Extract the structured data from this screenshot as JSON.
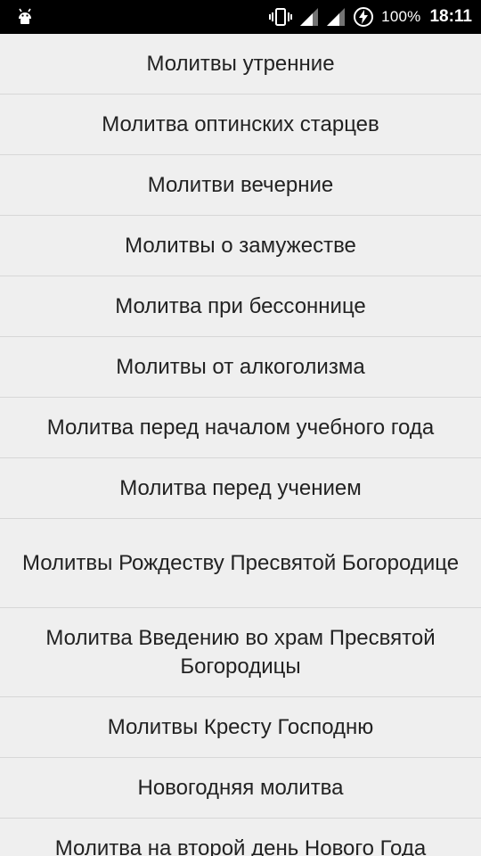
{
  "status_bar": {
    "left_icon": "android-notification-icon",
    "icons": [
      "vibrate-icon",
      "signal-icon",
      "signal-icon",
      "battery-charging-icon"
    ],
    "battery": "100%",
    "time": "18:11"
  },
  "prayers": {
    "items": [
      {
        "label": "Молитвы утренние"
      },
      {
        "label": "Молитва оптинских старцев"
      },
      {
        "label": "Молитви вечерние"
      },
      {
        "label": "Молитвы о замужестве"
      },
      {
        "label": "Молитва при бессоннице"
      },
      {
        "label": "Молитвы от алкоголизма"
      },
      {
        "label": "Молитва перед началом учебного года"
      },
      {
        "label": "Молитва перед учением"
      },
      {
        "label": "Молитвы Рождеству Пресвятой Богородице"
      },
      {
        "label": "Молитва Введению во храм Пресвятой Богородицы"
      },
      {
        "label": "Молитвы Кресту Господню"
      },
      {
        "label": "Новогодняя молитва"
      },
      {
        "label": "Молитва на второй день Нового Года"
      }
    ]
  }
}
